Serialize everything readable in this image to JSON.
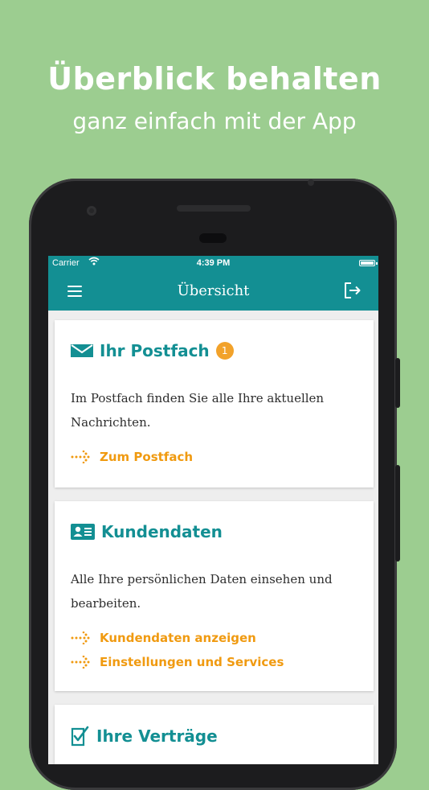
{
  "promo": {
    "headline": "Überblick behalten",
    "subline": "ganz einfach mit der App"
  },
  "status_bar": {
    "carrier": "Carrier",
    "time": "4:39 PM"
  },
  "app_bar": {
    "title": "Übersicht",
    "menu_icon": "hamburger-menu-icon",
    "logout_icon": "logout-icon"
  },
  "cards": [
    {
      "icon": "envelope-icon",
      "title": "Ihr Postfach",
      "badge": "1",
      "text": "Im Postfach finden Sie alle Ihre aktuellen Nachrichten.",
      "links": [
        "Zum Postfach"
      ]
    },
    {
      "icon": "id-card-icon",
      "title": "Kundendaten",
      "text": "Alle Ihre persönlichen Daten einsehen und bearbeiten.",
      "links": [
        "Kundendaten anzeigen",
        "Einstellungen und Services"
      ]
    },
    {
      "icon": "contract-check-icon",
      "title": "Ihre Verträge"
    }
  ],
  "colors": {
    "background": "#9ccd90",
    "primary": "#138f93",
    "accent": "#f09a10",
    "badge": "#f2a22a"
  }
}
